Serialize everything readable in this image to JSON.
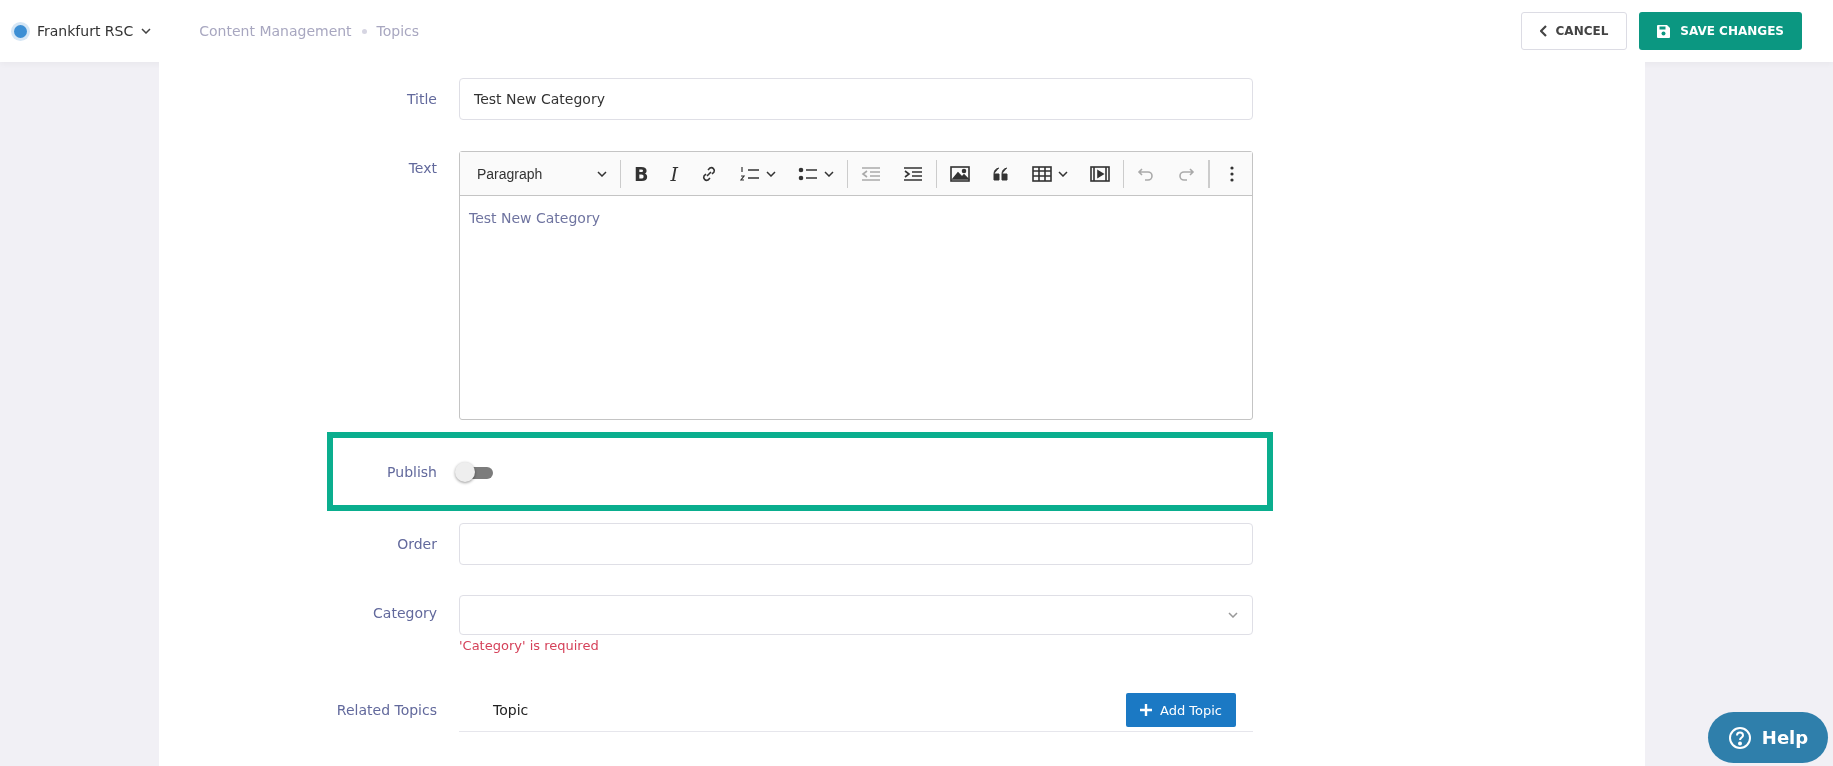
{
  "header": {
    "site": {
      "name": "Frankfurt RSC",
      "color": "#3d8fd4"
    },
    "breadcrumb": [
      "Content Management",
      "Topics"
    ],
    "cancel": "CANCEL",
    "save": "SAVE CHANGES"
  },
  "form": {
    "title": {
      "label": "Title",
      "value": "Test New Category"
    },
    "text": {
      "label": "Text",
      "content": "Test New Category",
      "toolbar": [
        {
          "items": [
            {
              "kind": "format",
              "label": "Paragraph",
              "dropdown": true,
              "disabled": false
            }
          ]
        },
        {
          "items": [
            {
              "kind": "bold",
              "label": "B",
              "dropdown": false,
              "disabled": false
            },
            {
              "kind": "italic",
              "label": "I",
              "dropdown": false,
              "disabled": false
            },
            {
              "kind": "link",
              "dropdown": false,
              "disabled": false
            },
            {
              "kind": "numbered-list",
              "dropdown": true,
              "disabled": false
            },
            {
              "kind": "bulleted-list",
              "dropdown": true,
              "disabled": false
            }
          ]
        },
        {
          "items": [
            {
              "kind": "outdent",
              "dropdown": false,
              "disabled": true
            },
            {
              "kind": "indent",
              "dropdown": false,
              "disabled": false
            }
          ]
        },
        {
          "items": [
            {
              "kind": "image",
              "dropdown": false,
              "disabled": false
            },
            {
              "kind": "quote",
              "dropdown": false,
              "disabled": false
            },
            {
              "kind": "table",
              "dropdown": true,
              "disabled": false
            },
            {
              "kind": "media",
              "dropdown": false,
              "disabled": false
            }
          ]
        },
        {
          "items": [
            {
              "kind": "undo",
              "dropdown": false,
              "disabled": true
            },
            {
              "kind": "redo",
              "dropdown": false,
              "disabled": true
            }
          ]
        },
        {
          "items": [
            {
              "kind": "more",
              "dropdown": false,
              "disabled": false
            }
          ]
        }
      ]
    },
    "publish": {
      "label": "Publish",
      "on": false,
      "highlighted": true
    },
    "order": {
      "label": "Order"
    },
    "category": {
      "label": "Category",
      "error": "'Category' is required"
    },
    "related": {
      "label": "Related Topics",
      "column": "Topic",
      "add": "Add Topic"
    }
  },
  "help": "Help"
}
